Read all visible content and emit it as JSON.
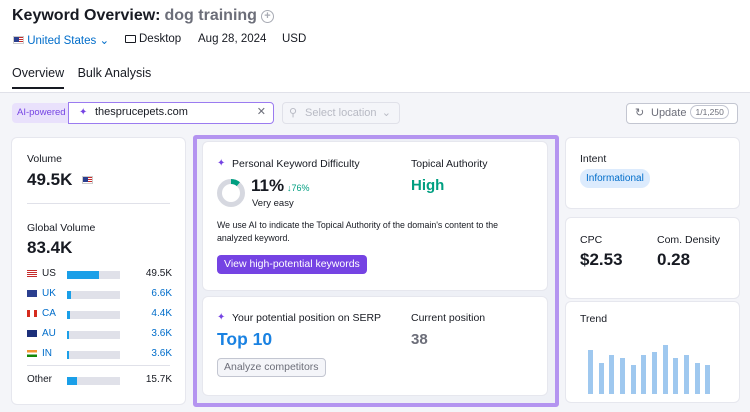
{
  "header": {
    "title": "Keyword Overview:",
    "keyword": "dog training",
    "database": "United States",
    "device": "Desktop",
    "date": "Aug 28, 2024",
    "currency": "USD"
  },
  "tabs": [
    {
      "label": "Overview",
      "active": true
    },
    {
      "label": "Bulk Analysis",
      "active": false
    }
  ],
  "filters": {
    "ai_badge": "AI-powered",
    "domain": "thesprucepets.com",
    "location_placeholder": "Select location",
    "update_label": "Update",
    "update_count": "1/1,250"
  },
  "volume": {
    "label": "Volume",
    "value": "49.5K",
    "global_label": "Global Volume",
    "global_value": "83.4K",
    "countries": [
      {
        "code": "US",
        "value": "49.5K",
        "share": 0.59
      },
      {
        "code": "UK",
        "value": "6.6K",
        "share": 0.08
      },
      {
        "code": "CA",
        "value": "4.4K",
        "share": 0.05
      },
      {
        "code": "AU",
        "value": "3.6K",
        "share": 0.04
      },
      {
        "code": "IN",
        "value": "3.6K",
        "share": 0.04
      }
    ],
    "other": {
      "label": "Other",
      "value": "15.7K",
      "share": 0.19
    }
  },
  "difficulty": {
    "label": "Personal Keyword Difficulty",
    "value": "11%",
    "change": "76%",
    "level": "Very easy",
    "authority_label": "Topical Authority",
    "authority_value": "High",
    "description": "We use AI to indicate the Topical Authority of the domain's content to the analyzed keyword.",
    "button": "View high-potential keywords"
  },
  "serp": {
    "label": "Your potential position on SERP",
    "value": "Top 10",
    "current_label": "Current position",
    "current_value": "38",
    "button": "Analyze competitors"
  },
  "intent": {
    "label": "Intent",
    "value": "Informational"
  },
  "cpc": {
    "label": "CPC",
    "value": "$2.53",
    "density_label": "Com. Density",
    "density_value": "0.28"
  },
  "trend": {
    "label": "Trend",
    "values": [
      0.85,
      0.6,
      0.75,
      0.7,
      0.55,
      0.75,
      0.8,
      0.95,
      0.7,
      0.75,
      0.6,
      0.55
    ]
  },
  "colors": {
    "accent": "#7543e3",
    "link": "#006dca",
    "good": "#009f81",
    "highlight": "#b494f0"
  }
}
